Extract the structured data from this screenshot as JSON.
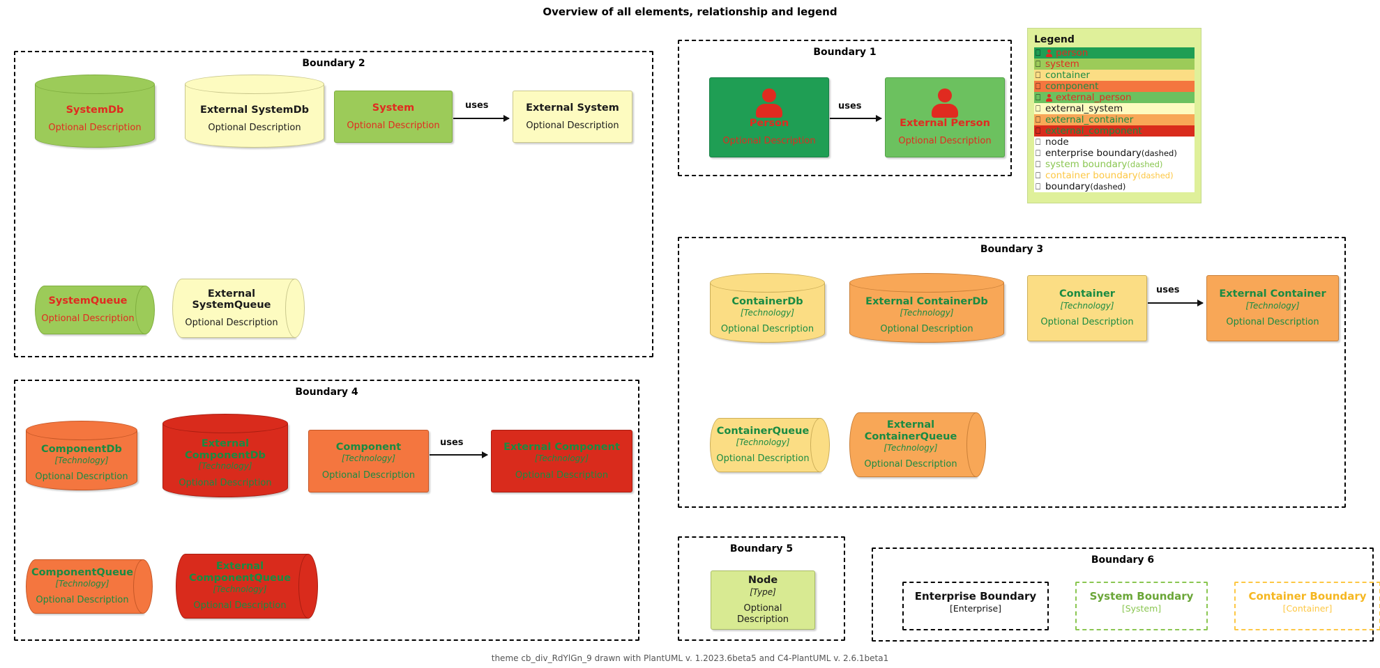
{
  "title": "Overview of all elements, relationship and legend",
  "footer": "theme cb_div_RdYlGn_9 drawn with PlantUML v. 1.2023.6beta5 and C4-PlantUML v. 2.6.1beta1",
  "labels": {
    "optional_description": "Optional Description",
    "technology": "[Technology]",
    "type": "[Type]",
    "uses": "uses"
  },
  "boundaries": {
    "b1": "Boundary 1",
    "b2": "Boundary 2",
    "b3": "Boundary 3",
    "b4": "Boundary 4",
    "b5": "Boundary 5",
    "b6": "Boundary 6"
  },
  "elements": {
    "person": {
      "name": "Person",
      "desc": "Optional Description"
    },
    "external_person": {
      "name": "External Person",
      "desc": "Optional Description"
    },
    "system_db": {
      "name": "SystemDb",
      "desc": "Optional Description"
    },
    "external_system_db": {
      "name": "External SystemDb",
      "desc": "Optional Description"
    },
    "system": {
      "name": "System",
      "desc": "Optional Description"
    },
    "external_system": {
      "name": "External System",
      "desc": "Optional Description"
    },
    "system_queue": {
      "name": "SystemQueue",
      "desc": "Optional Description"
    },
    "external_system_queue": {
      "name": "External\nSystemQueue",
      "line1": "External",
      "line2": "SystemQueue",
      "desc": "Optional Description"
    },
    "container_db": {
      "name": "ContainerDb",
      "tech": "[Technology]",
      "desc": "Optional Description"
    },
    "external_container_db": {
      "name": "External ContainerDb",
      "tech": "[Technology]",
      "desc": "Optional Description"
    },
    "container": {
      "name": "Container",
      "tech": "[Technology]",
      "desc": "Optional Description"
    },
    "external_container": {
      "name": "External Container",
      "tech": "[Technology]",
      "desc": "Optional Description"
    },
    "container_queue": {
      "name": "ContainerQueue",
      "tech": "[Technology]",
      "desc": "Optional Description"
    },
    "external_container_queue": {
      "line1": "External",
      "line2": "ContainerQueue",
      "tech": "[Technology]",
      "desc": "Optional Description"
    },
    "component_db": {
      "name": "ComponentDb",
      "tech": "[Technology]",
      "desc": "Optional Description"
    },
    "external_component_db": {
      "line1": "External",
      "line2": "ComponentDb",
      "tech": "[Technology]",
      "desc": "Optional Description"
    },
    "component": {
      "name": "Component",
      "tech": "[Technology]",
      "desc": "Optional Description"
    },
    "external_component": {
      "name": "External Component",
      "tech": "[Technology]",
      "desc": "Optional Description"
    },
    "component_queue": {
      "name": "ComponentQueue",
      "tech": "[Technology]",
      "desc": "Optional Description"
    },
    "external_component_queue": {
      "line1": "External",
      "line2": "ComponentQueue",
      "tech": "[Technology]",
      "desc": "Optional Description"
    },
    "node": {
      "name": "Node",
      "tech": "[Type]",
      "desc": "Optional Description"
    },
    "enterprise_boundary": {
      "name": "Enterprise Boundary",
      "tech": "[Enterprise]"
    },
    "system_boundary": {
      "name": "System Boundary",
      "tech": "[System]"
    },
    "container_boundary": {
      "name": "Container Boundary",
      "tech": "[Container]"
    }
  },
  "relationships": [
    {
      "label": "uses",
      "from": "Person",
      "to": "External Person"
    },
    {
      "label": "uses",
      "from": "System",
      "to": "External System"
    },
    {
      "label": "uses",
      "from": "Container",
      "to": "External Container"
    },
    {
      "label": "uses",
      "from": "Component",
      "to": "External Component"
    }
  ],
  "legend": {
    "title": "Legend",
    "items": [
      {
        "label": "person",
        "fill": "#1f9e54",
        "text": "#e02b20",
        "person_icon": true
      },
      {
        "label": "system",
        "fill": "#9ccb59",
        "text": "#e02b20",
        "person_icon": false
      },
      {
        "label": "container",
        "fill": "#fbdd84",
        "text": "#1a8b42",
        "person_icon": false
      },
      {
        "label": "component",
        "fill": "#f4763f",
        "text": "#1a8b42",
        "person_icon": false
      },
      {
        "label": "external_person",
        "fill": "#6cc15f",
        "text": "#e02b20",
        "person_icon": true
      },
      {
        "label": "external_system",
        "fill": "#fdfbc0",
        "text": "#1b1b1b",
        "person_icon": false
      },
      {
        "label": "external_container",
        "fill": "#f8a757",
        "text": "#1a8b42",
        "person_icon": false
      },
      {
        "label": "external_component",
        "fill": "#d92b1c",
        "text": "#1a8b42",
        "person_icon": false
      },
      {
        "label": "node",
        "fill": "#ffffff",
        "text": "#1b1b1b",
        "person_icon": false
      }
    ],
    "boundary_items": [
      {
        "label": "enterprise boundary",
        "suffix": "(dashed)",
        "fill": "#ffffff",
        "text": "#111111"
      },
      {
        "label": "system boundary",
        "suffix": "(dashed)",
        "fill": "#ffffff",
        "text": "#8ac651"
      },
      {
        "label": "container boundary",
        "suffix": "(dashed)",
        "fill": "#ffffff",
        "text": "#fdc743"
      },
      {
        "label": "boundary",
        "suffix": "(dashed)",
        "fill": "#ffffff",
        "text": "#111111"
      }
    ]
  }
}
